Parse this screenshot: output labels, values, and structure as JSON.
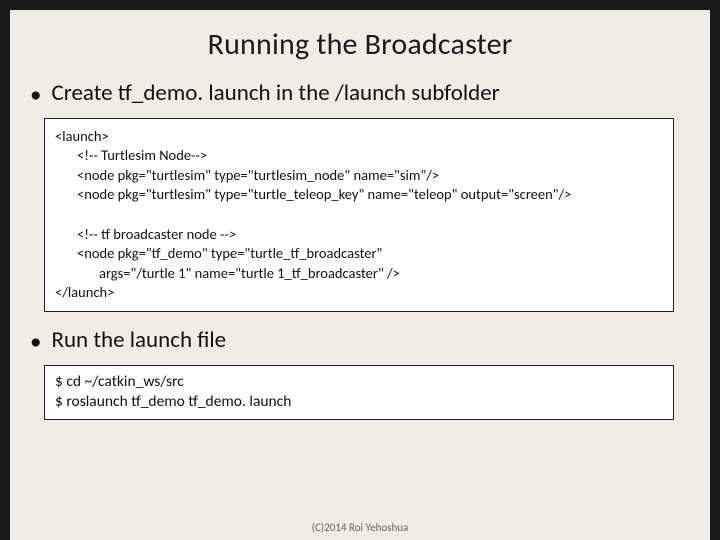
{
  "title": "Running the Broadcaster",
  "bullets": {
    "b1": "Create tf_demo. launch in the /launch subfolder",
    "b2": "Run the launch file"
  },
  "code1": {
    "l1": "<launch>",
    "l2": "<!-- Turtlesim Node-->",
    "l3": "<node pkg=\"turtlesim\" type=\"turtlesim_node\" name=\"sim\"/>",
    "l4": "<node pkg=\"turtlesim\" type=\"turtle_teleop_key\" name=\"teleop\" output=\"screen\"/>",
    "l5": "",
    "l6": "<!-- tf broadcaster node -->",
    "l7": "<node pkg=\"tf_demo\" type=\"turtle_tf_broadcaster\"",
    "l8": "args=\"/turtle 1\" name=\"turtle 1_tf_broadcaster\" />",
    "l9": "</launch>"
  },
  "code2": {
    "l1": "$ cd ~/catkin_ws/src",
    "l2": "$ roslaunch tf_demo tf_demo. launch"
  },
  "footer": "(C)2014 Roi Yehoshua"
}
